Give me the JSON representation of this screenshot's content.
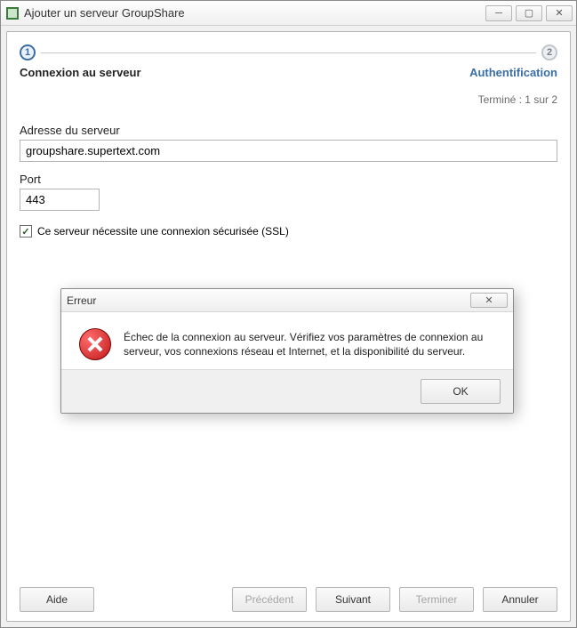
{
  "window": {
    "title": "Ajouter un serveur GroupShare"
  },
  "wizard": {
    "step1_num": "1",
    "step2_num": "2",
    "step1_label": "Connexion au serveur",
    "step2_label": "Authentification",
    "progress": "Terminé : 1 sur 2"
  },
  "form": {
    "server_label": "Adresse du serveur",
    "server_value": "groupshare.supertext.com",
    "port_label": "Port",
    "port_value": "443",
    "ssl_label": "Ce serveur nécessite une connexion sécurisée (SSL)"
  },
  "buttons": {
    "help": "Aide",
    "prev": "Précédent",
    "next": "Suivant",
    "finish": "Terminer",
    "cancel": "Annuler"
  },
  "dialog": {
    "title": "Erreur",
    "message": "Échec de la connexion au serveur. Vérifiez vos paramètres de connexion au serveur, vos connexions réseau et Internet, et la disponibilité du serveur.",
    "ok": "OK"
  }
}
